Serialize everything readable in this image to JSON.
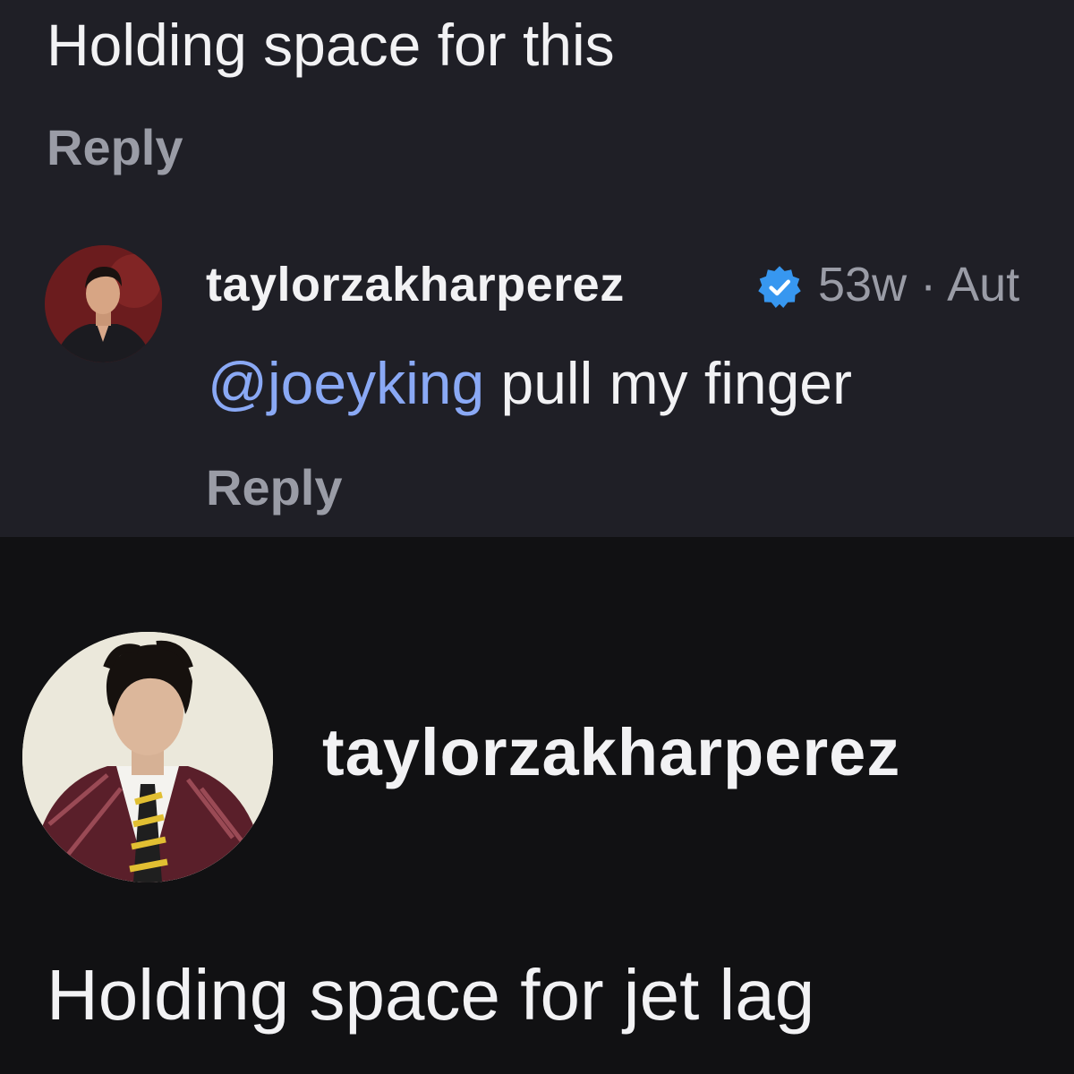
{
  "thread": {
    "parent_comment": {
      "text": "Holding space for this",
      "reply_label": "Reply"
    },
    "reply_comment": {
      "avatar_icon": "profile-photo-avatar",
      "username": "taylorzakharperez",
      "verified_icon": "verified-badge-icon",
      "verified_color": "#3797f0",
      "meta": "53w · Aut",
      "mention": "@joeyking",
      "text": " pull my finger",
      "mention_color": "#8aa9f5",
      "reply_label": "Reply"
    }
  },
  "post": {
    "avatar_icon": "profile-photo-avatar",
    "username": "taylorzakharperez",
    "caption": "Holding space for jet lag"
  }
}
